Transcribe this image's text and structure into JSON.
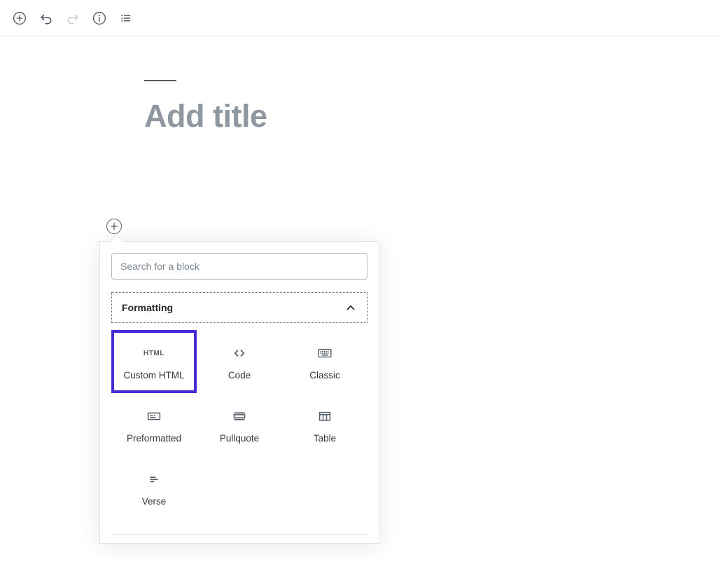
{
  "toolbar": {
    "buttons": [
      {
        "name": "add-block-button",
        "icon": "plus-circle-icon",
        "label": "Add block",
        "disabled": false
      },
      {
        "name": "undo-button",
        "icon": "undo-icon",
        "label": "Undo",
        "disabled": false
      },
      {
        "name": "redo-button",
        "icon": "redo-icon",
        "label": "Redo",
        "disabled": true
      },
      {
        "name": "content-info-button",
        "icon": "info-circle-icon",
        "label": "Content structure",
        "disabled": false
      },
      {
        "name": "block-navigation-button",
        "icon": "list-view-icon",
        "label": "Block navigation",
        "disabled": false
      }
    ]
  },
  "post": {
    "title_placeholder": "Add title"
  },
  "inserter": {
    "toggle_label": "Add block",
    "search": {
      "placeholder": "Search for a block",
      "value": ""
    },
    "panel": {
      "title": "Formatting",
      "expanded": true,
      "chevron": "chevron-up-icon"
    },
    "blocks": [
      {
        "label": "Custom HTML",
        "icon": "html-badge-icon",
        "selected": true
      },
      {
        "label": "Code",
        "icon": "code-brackets-icon",
        "selected": false
      },
      {
        "label": "Classic",
        "icon": "keyboard-icon",
        "selected": false
      },
      {
        "label": "Preformatted",
        "icon": "preformatted-icon",
        "selected": false
      },
      {
        "label": "Pullquote",
        "icon": "pullquote-icon",
        "selected": false
      },
      {
        "label": "Table",
        "icon": "table-icon",
        "selected": false
      },
      {
        "label": "Verse",
        "icon": "verse-lines-icon",
        "selected": false
      }
    ]
  },
  "colors": {
    "selection_accent": "#4a29d6",
    "icon_grey": "#555d66",
    "placeholder_grey": "#8f98a1",
    "border_grey": "#e2e4e7"
  }
}
